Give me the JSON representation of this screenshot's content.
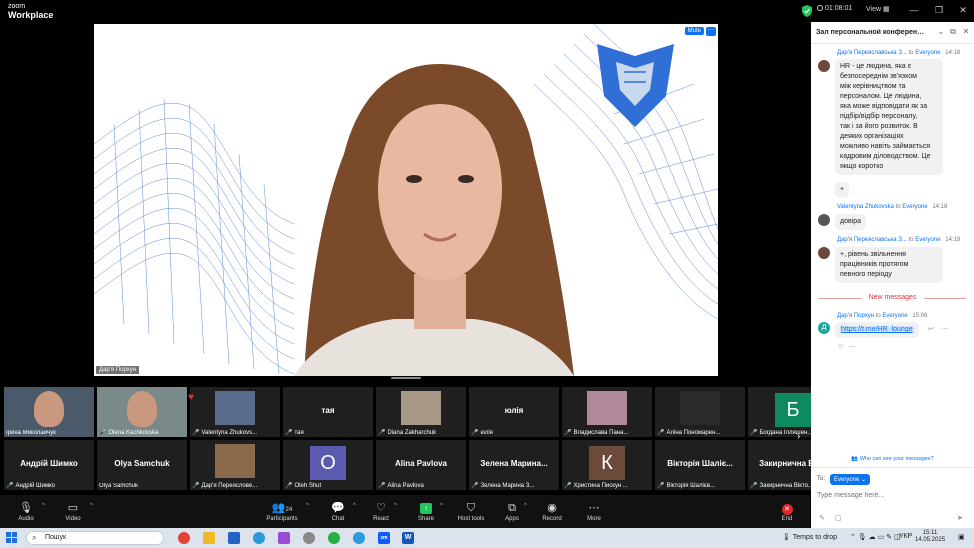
{
  "app": {
    "logo_line1": "zoom",
    "logo_line2": "Workplace",
    "timer": "01:08:01",
    "view_label": "View"
  },
  "main_video": {
    "speaker_name": "Дар'я Порхун",
    "mute_label": "Mute",
    "more_label": "···"
  },
  "gallery": {
    "tiles": [
      {
        "name": "Ірина Миколайчук",
        "muted": false,
        "kind": "photo",
        "bg": "#4a5a6a"
      },
      {
        "name": "Olena Kachkovska",
        "muted": true,
        "kind": "photo",
        "bg": "#7a8a8a"
      },
      {
        "name": "Valentyna Zhukovs...",
        "muted": true,
        "kind": "thumb",
        "bg": "#5a6a8a"
      },
      {
        "name": "тая",
        "muted": true,
        "kind": "text",
        "big": "тая"
      },
      {
        "name": "Diana Zakharchuk",
        "muted": true,
        "kind": "thumb",
        "bg": "#a89888"
      },
      {
        "name": "юлія",
        "muted": true,
        "kind": "text",
        "big": "юлія"
      },
      {
        "name": "Владислава Пана...",
        "muted": true,
        "kind": "thumb",
        "bg": "#b08a9a"
      },
      {
        "name": "Аліна Пономарен...",
        "muted": true,
        "kind": "thumb",
        "bg": "#2a2a2a"
      },
      {
        "name": "Богдана Ілляшен...",
        "muted": true,
        "kind": "letter",
        "big": "Б",
        "bg": "#0e8a5e"
      },
      {
        "name": "Андрій Шимко",
        "muted": true,
        "kind": "text",
        "big": "Андрій Шимко"
      },
      {
        "name": "Olya Samchuk",
        "muted": false,
        "kind": "text",
        "big": "Olya Samchuk"
      },
      {
        "name": "Дар'я Переяслове...",
        "muted": true,
        "kind": "thumb",
        "bg": "#8a6a4a"
      },
      {
        "name": "Oleh Shut",
        "muted": true,
        "kind": "letter",
        "big": "O",
        "bg": "#5a5ab0"
      },
      {
        "name": "Alina Pavlova",
        "muted": true,
        "kind": "text",
        "big": "Alina Pavlova"
      },
      {
        "name": "Зелена Марина З...",
        "muted": true,
        "kind": "text",
        "big": "Зелена Марина..."
      },
      {
        "name": "Христина Пискун ...",
        "muted": true,
        "kind": "letter",
        "big": "К",
        "bg": "#6b4a3a"
      },
      {
        "name": "Вікторія Шалієв...",
        "muted": true,
        "kind": "text",
        "big": "Вікторія Шаліє..."
      },
      {
        "name": "Закирничнa Вікто...",
        "muted": true,
        "kind": "text",
        "big": "Закирнична Вік..."
      }
    ],
    "next_arrow": "›"
  },
  "toolbar": {
    "audio": "Audio",
    "video": "Video",
    "participants": "Participants",
    "participants_count": "24",
    "chat": "Chat",
    "react": "React",
    "share": "Share",
    "host_tools": "Host tools",
    "apps": "Apps",
    "record": "Record",
    "more": "More",
    "end": "End"
  },
  "chat": {
    "title": "Зал персональной конференции ...",
    "messages": [
      {
        "from": "Дар'я Переяславська З...",
        "to_word": "to",
        "to": "Everyone",
        "time": "14:18",
        "lines": [
          "HR - це людина, яка є",
          "безпосереднім зв'язком",
          "між керівництвом та",
          "персоналом. Це людина,",
          "яка може відповідати як за",
          "підбір/відбір персоналу,",
          "так і за його розвиток. В",
          "деяких організаціях",
          "можливо навіть займається",
          "кадровим діловодством. Це",
          "якщо коротко"
        ],
        "extra": "+"
      },
      {
        "from": "Valentyna Zhukovska",
        "to_word": "to",
        "to": "Everyone",
        "time": "14:18",
        "text": "довіра"
      },
      {
        "from": "Дар'я Переяславська З...",
        "to_word": "to",
        "to": "Everyone",
        "time": "14:19",
        "lines": [
          "+, рівень звільнення",
          "працівників протягом",
          "певного періоду"
        ]
      }
    ],
    "new_messages": "New messages",
    "new_message": {
      "from": "Дар'я Порхун",
      "to_word": "to",
      "to": "Everyone",
      "time": "15:06",
      "link": "https://t.me/HR_lounge",
      "avatar": "Д"
    },
    "who_can_see": "Who can see your messages?",
    "to_label": "To:",
    "to_value": "Everyone",
    "input_placeholder": "Type message here..."
  },
  "taskbar": {
    "search_text": "Пошук",
    "temps": "Temps to drop",
    "lang": "УКР",
    "time": "15:11",
    "date": "14.05.2025"
  }
}
